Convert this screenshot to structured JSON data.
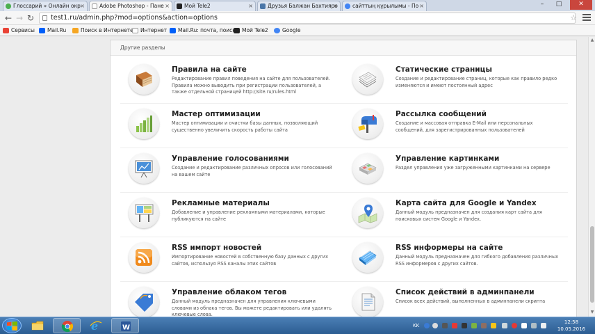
{
  "browser": {
    "tabs": [
      {
        "title": "Глоссарий » Онлайн окр",
        "color": "#4caf50",
        "active": false
      },
      {
        "title": "Adobe Photoshop - Пане",
        "color": "#e0e0e0",
        "active": true
      },
      {
        "title": "Мой Tele2",
        "color": "#222222",
        "active": false
      },
      {
        "title": "Друзья Балжан Бахтияро",
        "color": "#4a76a8",
        "active": false
      },
      {
        "title": "сайттың құрылымы - По",
        "color": "#4285f4",
        "active": false
      }
    ],
    "address": "test1.ru/admin.php?mod=options&action=options",
    "bookmarks": [
      {
        "label": "Сервисы",
        "color": "#e94235"
      },
      {
        "label": "Mail.Ru",
        "color": "#005ff9"
      },
      {
        "label": "Поиск в Интернете",
        "color": "#f5a623"
      },
      {
        "label": "Интернет",
        "color": "#cccccc"
      },
      {
        "label": "Mail.Ru: почта, поиск",
        "color": "#005ff9"
      },
      {
        "label": "Мой Tele2",
        "color": "#222222"
      },
      {
        "label": "Google",
        "color": "#4285f4"
      }
    ]
  },
  "panel": {
    "header": "Другие разделы",
    "items": [
      {
        "title": "Правила на сайте",
        "desc": "Редактирование правил поведения на сайте для пользователей. Правила можно выводить при регистрации пользователей, а также отдельной страницей http://site.ru/rules.html",
        "icon": "book-icon"
      },
      {
        "title": "Статические страницы",
        "desc": "Создание и редактирование страниц, которые как правило редко изменяются и имеют постоянный адрес",
        "icon": "pages-icon"
      },
      {
        "title": "Мастер оптимизации",
        "desc": "Мастер оптимизации и очистки базы данных, позволяющий существенно увеличить скорость работы сайта",
        "icon": "bar-chart-icon"
      },
      {
        "title": "Рассылка сообщений",
        "desc": "Создание и массовая отправка E-Mail или персональных сообщений, для зарегистрированных пользователей",
        "icon": "mailbox-icon"
      },
      {
        "title": "Управление голосованиями",
        "desc": "Создание и редактирование различных опросов или голосований на вашем сайте",
        "icon": "presentation-icon"
      },
      {
        "title": "Управление картинками",
        "desc": "Раздел управления уже загруженными картинками на сервере",
        "icon": "images-icon"
      },
      {
        "title": "Рекламные материалы",
        "desc": "Добавление и управление рекламными материалами, которые публикуются на сайте",
        "icon": "billboard-icon"
      },
      {
        "title": "Карта сайта для Google и Yandex",
        "desc": "Данный модуль предназначен для создания карт сайта для поисковых систем Google и Yandex.",
        "icon": "map-pin-icon"
      },
      {
        "title": "RSS импорт новостей",
        "desc": "Импортирование новостей в собственную базу данных с других сайтов, используя RSS каналы этих сайтов",
        "icon": "rss-icon"
      },
      {
        "title": "RSS информеры на сайте",
        "desc": "Данный модуль предназначен для гибкого добавления различных RSS информеров с других сайтов.",
        "icon": "notebook-icon"
      },
      {
        "title": "Управление облаком тегов",
        "desc": "Данный модуль предназначен для управления ключевыми словами из облака тегов. Вы можете редактировать или удалять ключевые слова.",
        "icon": "tag-icon"
      },
      {
        "title": "Список действий в админпанели",
        "desc": "Список всех действий, выполненных в админпанели скрипта",
        "icon": "document-icon"
      }
    ]
  },
  "taskbar": {
    "lang": "KK",
    "time": "12:58",
    "date": "10.05.2016"
  }
}
